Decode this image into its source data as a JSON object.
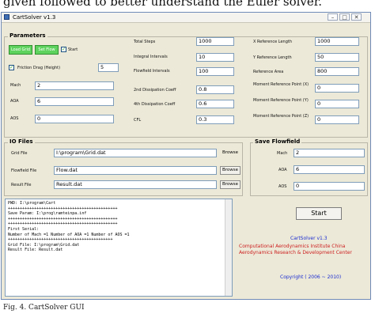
{
  "document": {
    "intro_text": "given followed to better understand the Euler solver.",
    "figure_caption": "Fig. 4. CartSolver GUI"
  },
  "window": {
    "title": "CartSolver v1.3",
    "min_label": "–",
    "max_label": "□",
    "close_label": "✕"
  },
  "parameters": {
    "title": "Parameters",
    "button1_label": "Load Grid",
    "button2_label": "Set Flow",
    "start_check_label": "Start",
    "start_checked": "✓",
    "friction_check": "✓",
    "friction_label": "Friction Drag (Height)",
    "friction_value": "5",
    "mach_label": "Mach",
    "mach_value": "2",
    "aoa_label": "AOA",
    "aoa_value": "6",
    "aos_label": "AOS",
    "aos_value": "0",
    "total_steps_label": "Total Steps",
    "total_steps_value": "1000",
    "integral_intervals_label": "Integral Intervals",
    "integral_intervals_value": "10",
    "flowfield_intervals_label": "Flowfield Intervals",
    "flowfield_intervals_value": "100",
    "dissipation2_label": "2nd Dissipation Coeff",
    "dissipation2_value": "0.8",
    "dissipation4_label": "4th Dissipation Coeff",
    "dissipation4_value": "0.6",
    "cfl_label": "CFL",
    "cfl_value": "0.3",
    "xref_label": "X Reference Length",
    "xref_value": "1000",
    "yref_label": "Y Reference Length",
    "yref_value": "50",
    "ref_area_label": "Reference Area",
    "ref_area_value": "800",
    "moment_x_label": "Moment Reference Point (X)",
    "moment_x_value": "0",
    "moment_y_label": "Moment Reference Point (Y)",
    "moment_y_value": "0",
    "moment_z_label": "Moment Reference Point (Z)",
    "moment_z_value": "0"
  },
  "io_files": {
    "title": "IO Files",
    "grid_label": "Grid File",
    "grid_value": "I:\\program\\Grid.dat",
    "grid_button": "Browse",
    "flowfield_label": "Flowfield File",
    "flowfield_value": "Flow.dat",
    "flowfield_button": "Browse",
    "result_label": "Result File",
    "result_value": "Result.dat",
    "result_button": "Browse"
  },
  "save_flowfield": {
    "title": "Save Flowfield",
    "mach_label": "Mach",
    "mach_value": "2",
    "aoa_label": "AOA",
    "aoa_value": "6",
    "aos_label": "AOS",
    "aos_value": "0"
  },
  "console": {
    "lines": [
      "PWD: I:\\program\\Cart",
      "++++++++++++++++++++++++++++++++++++++++++++++",
      "Save Param: I:\\prog\\ramteinpa.inf",
      "++++++++++++++++++++++++++++++++++++++++++++++",
      "++++++++++++++++++++++++++++++++++++++++++++++",
      "First Serial:",
      "  Number of Mach =1     Number of AOA =1     Number of AOS =1",
      "  ++++++++++++++++++++++++++++++++++++++++++++",
      "Grid File: I:\\program\\Grid.dat",
      "Result File: Result.dat"
    ]
  },
  "actions": {
    "start_label": "Start"
  },
  "credits": {
    "name": "CartSolver v1.3",
    "org": "Computational Aerodynamics Institute China Aerodynamics Research & Development Center",
    "copyright": "Copyright  ( 2006 ~ 2010)"
  }
}
